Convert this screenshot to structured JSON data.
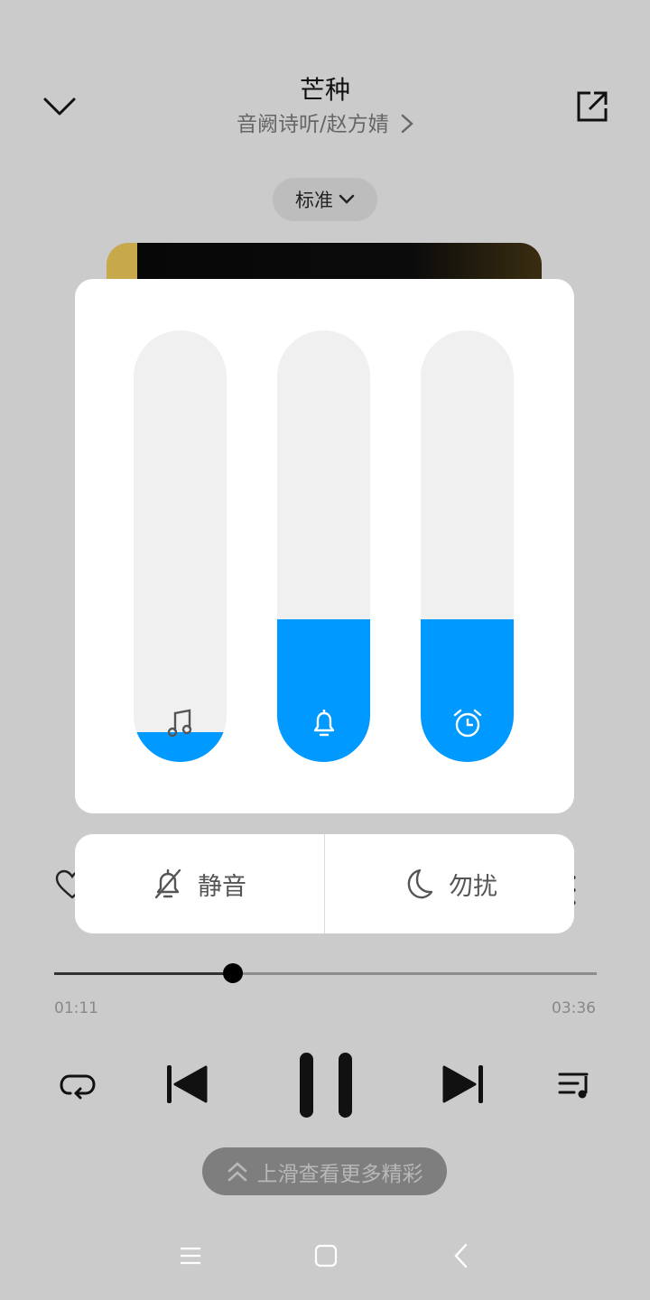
{
  "header": {
    "song_title": "芒种",
    "artist_album": "音阙诗听/赵方婧",
    "collapse_icon": "chevron-down-icon",
    "share_icon": "share-icon"
  },
  "quality": {
    "label": "标准"
  },
  "volume_panel": {
    "sliders": [
      {
        "name": "media",
        "icon": "music-note-icon",
        "level_percent": 7
      },
      {
        "name": "ringtone",
        "icon": "bell-icon",
        "level_percent": 33
      },
      {
        "name": "alarm",
        "icon": "alarm-clock-icon",
        "level_percent": 33
      }
    ],
    "accent_color": "#0099ff"
  },
  "quick_actions": {
    "mute_label": "静音",
    "dnd_label": "勿扰"
  },
  "progress": {
    "current": "01:11",
    "total": "03:36",
    "fraction": 0.33
  },
  "swipe_hint": {
    "label": "上滑查看更多精彩"
  }
}
